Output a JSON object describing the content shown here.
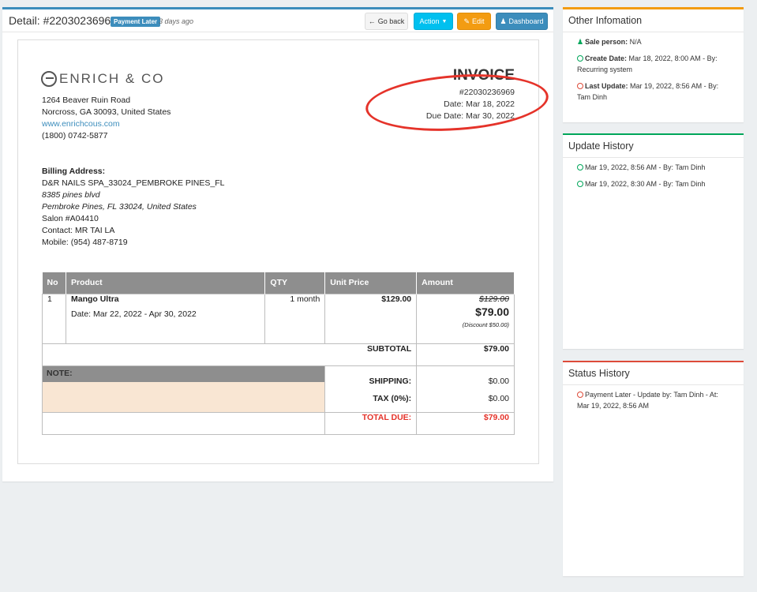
{
  "header": {
    "title": "Detail: #22030236969",
    "status": "Payment Later",
    "time_ago": "3 days ago",
    "buttons": {
      "back": "Go back",
      "action": "Action",
      "edit": "Edit",
      "dashboard": "Dashboard"
    }
  },
  "invoice": {
    "company": {
      "name": "ENRICH & CO",
      "address1": "1264 Beaver Ruin Road",
      "address2": "Norcross, GA 30093, United States",
      "website": "www.enrichcous.com",
      "phone": "(1800) 0742-5877"
    },
    "title": "INVOICE",
    "number": "#22030236969",
    "date": "Date: Mar 18, 2022",
    "due_date": "Due Date: Mar 30, 2022",
    "billing": {
      "heading": "Billing Address:",
      "name": "D&R NAILS SPA_33024_PEMBROKE PINES_FL",
      "street": "8385 pines blvd",
      "city": "Pembroke Pines, FL 33024, United States",
      "salon": "Salon #A04410",
      "contact": "Contact: MR TAI LA",
      "mobile": "Mobile: (954) 487-8719"
    },
    "table": {
      "headers": [
        "No",
        "Product",
        "QTY",
        "Unit Price",
        "Amount"
      ],
      "item": {
        "no": "1",
        "product": "Mango Ultra",
        "period": "Date: Mar 22, 2022 - Apr 30, 2022",
        "qty": "1 month",
        "unit_price": "$129.00",
        "old_amount": "$129.00",
        "amount": "$79.00",
        "discount": "(Discount $50.00)"
      },
      "subtotal_label": "SUBTOTAL",
      "subtotal": "$79.00",
      "note_label": "NOTE:",
      "shipping_label": "SHIPPING:",
      "shipping": "$0.00",
      "tax_label": "TAX (0%):",
      "tax": "$0.00",
      "total_label": "TOTAL DUE:",
      "total": "$79.00"
    }
  },
  "other_info": {
    "title": "Other Infomation",
    "sale_person_label": "Sale person:",
    "sale_person": "N/A",
    "create_label": "Create Date:",
    "create": "Mar 18, 2022, 8:00 AM - By: Recurring system",
    "update_label": "Last Update:",
    "update": "Mar 19, 2022, 8:56 AM - By: Tam Dinh"
  },
  "update_history": {
    "title": "Update History",
    "items": [
      "Mar 19, 2022, 8:56 AM - By: Tam Dinh",
      "Mar 19, 2022, 8:30 AM - By: Tam Dinh"
    ]
  },
  "status_history": {
    "title": "Status History",
    "items": [
      "Payment Later - Update by: Tam Dinh - At: Mar 19, 2022, 8:56 AM"
    ]
  },
  "colors": {
    "primary": "#3c8dbc",
    "info": "#00c0ef",
    "warning": "#f39c12",
    "success": "#00a65a",
    "danger": "#dd4b39",
    "annotation": "#e5332a"
  }
}
